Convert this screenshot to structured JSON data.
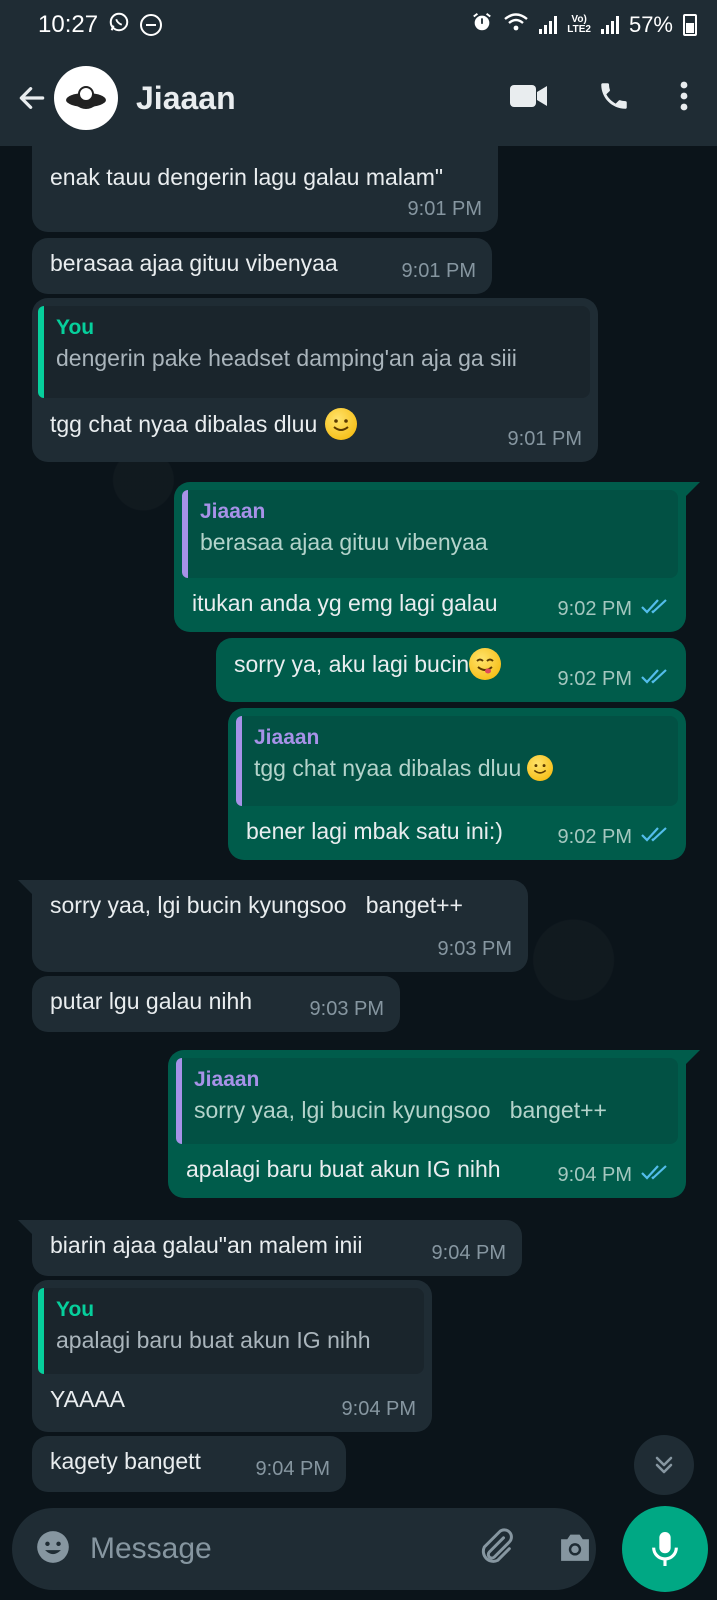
{
  "status_bar": {
    "time": "10:27",
    "lte_top": "Vo)",
    "lte_bottom": "LTE2",
    "battery": "57%"
  },
  "header": {
    "contact_name": "Jiaaan",
    "icons": [
      "back-arrow-icon",
      "video-call-icon",
      "phone-icon",
      "more-options-icon"
    ]
  },
  "messages": [
    {
      "dir": "in",
      "text": "enak tauu dengerin lagu galau malam\"",
      "time": "9:01 PM"
    },
    {
      "dir": "in",
      "text": "berasaa ajaa gituu vibenyaa",
      "time": "9:01 PM"
    },
    {
      "dir": "in",
      "quote_author": "You",
      "quote_text": "dengerin pake headset damping'an aja ga siii",
      "text": "tgg chat nyaa dibalas dluu",
      "time": "9:01 PM"
    },
    {
      "dir": "out",
      "quote_author": "Jiaaan",
      "quote_text": "berasaa ajaa gituu vibenyaa",
      "text": "itukan anda yg emg lagi galau",
      "time": "9:02 PM"
    },
    {
      "dir": "out",
      "text": "sorry ya, aku lagi bucin",
      "time": "9:02 PM"
    },
    {
      "dir": "out",
      "quote_author": "Jiaaan",
      "quote_text": "tgg chat nyaa dibalas dluu",
      "text": "bener lagi mbak satu ini:)",
      "time": "9:02 PM"
    },
    {
      "dir": "in",
      "text": "sorry yaa, lgi bucin kyungsoo   banget++",
      "time": "9:03 PM"
    },
    {
      "dir": "in",
      "text": "putar lgu galau nihh",
      "time": "9:03 PM"
    },
    {
      "dir": "out",
      "quote_author": "Jiaaan",
      "quote_text": "sorry yaa, lgi bucin kyungsoo   banget++",
      "text": "apalagi baru buat akun IG nihh",
      "time": "9:04 PM"
    },
    {
      "dir": "in",
      "text": "biarin ajaa galau\"an malem inii",
      "time": "9:04 PM"
    },
    {
      "dir": "in",
      "quote_author": "You",
      "quote_text": "apalagi baru buat akun IG nihh",
      "text": "YAAAA",
      "time": "9:04 PM"
    },
    {
      "dir": "in",
      "text": "kagety bangett",
      "time": "9:04 PM"
    }
  ],
  "input": {
    "placeholder": "Message"
  },
  "colors": {
    "header_bg": "#1f2c34",
    "incoming_bubble": "#1f2c34",
    "outgoing_bubble": "#005c4b",
    "accent": "#00a884",
    "read_ticks": "#53bdeb"
  }
}
